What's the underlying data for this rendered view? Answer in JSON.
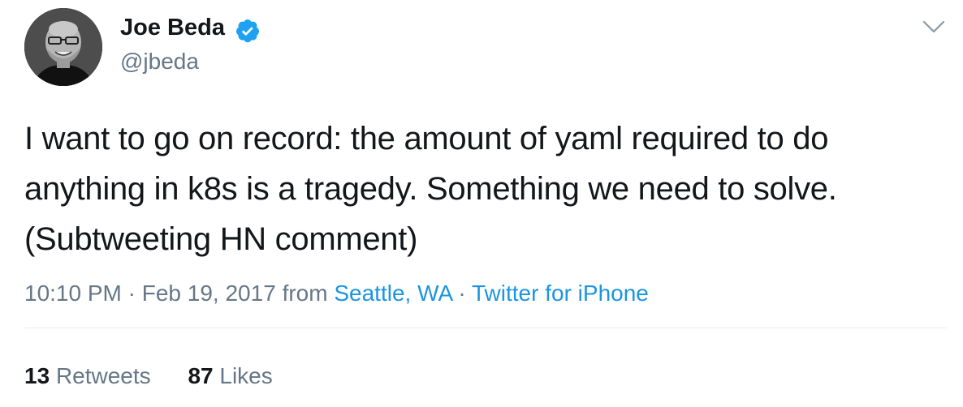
{
  "author": {
    "name": "Joe Beda",
    "handle": "@jbeda",
    "verified": true
  },
  "tweet": {
    "text": "I want to go on record: the amount of yaml required to do anything in k8s is a tragedy. Something we need to solve. (Subtweeting HN comment)"
  },
  "meta": {
    "time": "10:10 PM",
    "sep1": "·",
    "date": "Feb 19, 2017",
    "from": "from",
    "location": "Seattle, WA",
    "sep2": "·",
    "source": "Twitter for iPhone"
  },
  "stats": {
    "retweets_count": "13",
    "retweets_label": "Retweets",
    "likes_count": "87",
    "likes_label": "Likes"
  },
  "colors": {
    "text": "#14171a",
    "secondary": "#657786",
    "link": "#1b95e0",
    "verified": "#1da1f2",
    "divider": "#e6ecf0"
  },
  "icons": {
    "verified": "verified-badge-icon",
    "caret": "chevron-down-icon"
  }
}
